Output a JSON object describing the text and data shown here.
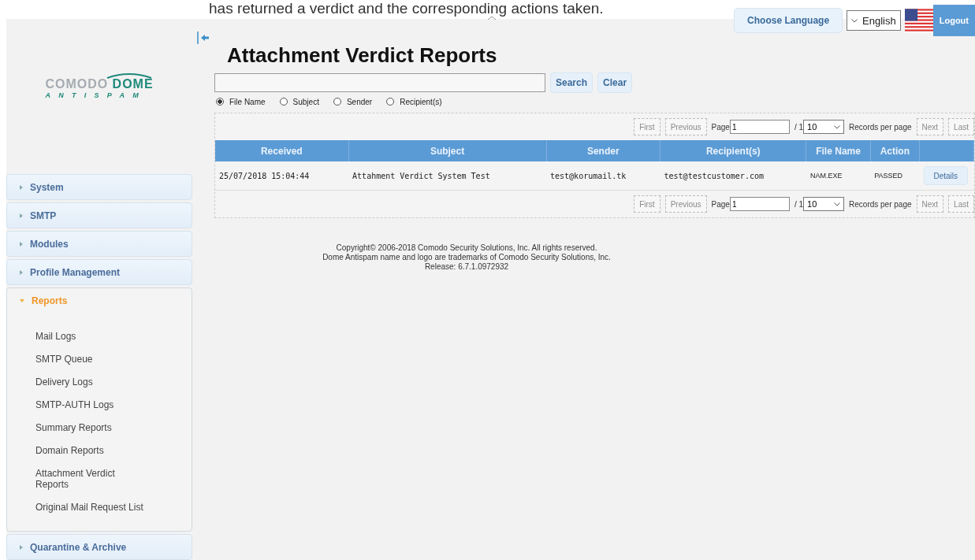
{
  "caption": "has returned a verdict and the corresponding actions taken.",
  "top_bar": {
    "language_button": "Choose Language",
    "language_select": "English",
    "logout": "Logout"
  },
  "logo": {
    "brand": "COMODO",
    "product": "DOME",
    "sub": "ANTISPAM"
  },
  "sidebar": {
    "items": [
      {
        "label": "System",
        "expanded": false
      },
      {
        "label": "SMTP",
        "expanded": false
      },
      {
        "label": "Modules",
        "expanded": false
      },
      {
        "label": "Profile Management",
        "expanded": false
      },
      {
        "label": "Reports",
        "expanded": true,
        "children": [
          {
            "label": "Mail Logs"
          },
          {
            "label": "SMTP Queue"
          },
          {
            "label": "Delivery Logs"
          },
          {
            "label": "SMTP-AUTH Logs"
          },
          {
            "label": "Summary Reports"
          },
          {
            "label": "Domain Reports"
          },
          {
            "label": "Attachment Verdict Reports"
          },
          {
            "label": "Original Mail Request List"
          }
        ]
      },
      {
        "label": "Quarantine & Archive",
        "expanded": false
      }
    ]
  },
  "title": "Attachment Verdict Reports",
  "search": {
    "buttons": [
      "Search",
      "Clear"
    ],
    "filters": [
      {
        "label": "File Name",
        "selected": true
      },
      {
        "label": "Subject",
        "selected": false
      },
      {
        "label": "Sender",
        "selected": false
      },
      {
        "label": "Recipient(s)",
        "selected": false
      }
    ]
  },
  "pagers": [
    {
      "first": "First",
      "previous": "Previous",
      "page_label": "Page",
      "page": "1",
      "total": "/ 1",
      "per_page": "10",
      "per_page_label": "Records per page",
      "next": "Next",
      "last": "Last",
      "disabled": true
    },
    {
      "first": "First",
      "previous": "Previous",
      "page_label": "Page",
      "page": "1",
      "total": "/ 1",
      "per_page": "10",
      "per_page_label": "Records per page",
      "next": "Next",
      "last": "Last",
      "disabled": true
    }
  ],
  "table": {
    "columns": [
      "Received",
      "Subject",
      "Sender",
      "Recipient(s)",
      "File Name",
      "Action"
    ],
    "rows": [
      {
        "cells": [
          "25/07/2018 15:04:44",
          "Attahment Verdict System Test",
          "test@korumail.tk",
          "test@testcustomer.com",
          "NAM.EXE",
          "PASSED"
        ],
        "button": "Details"
      }
    ]
  },
  "footer": [
    "Copyright© 2006-2018 Comodo Security Solutions, Inc. All rights reserved.",
    "Dome Antispam name and logo are trademarks of Comodo Security Solutions, Inc.",
    "Release: 6.7.1.0972932"
  ]
}
